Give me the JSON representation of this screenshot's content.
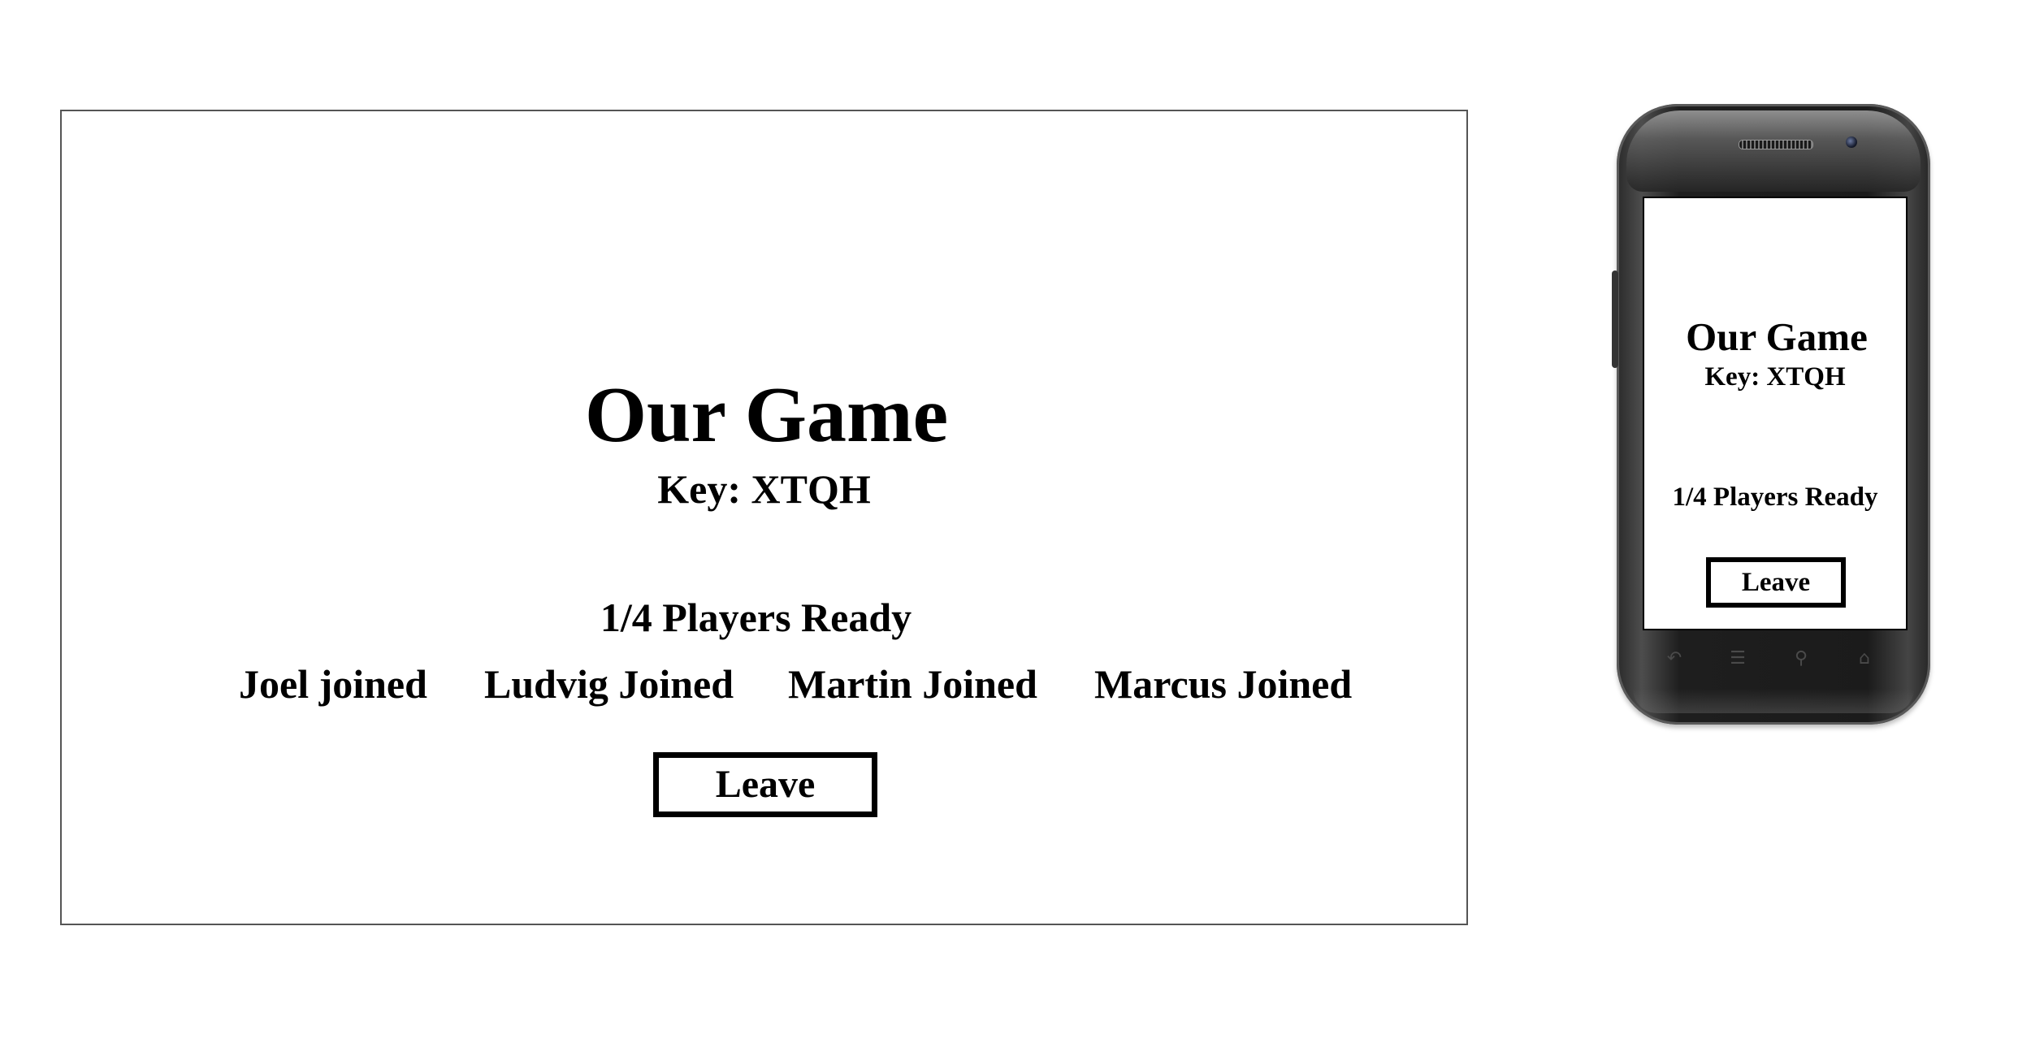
{
  "desktop": {
    "title": "Our Game",
    "key": "Key: XTQH",
    "ready_status": "1/4 Players Ready",
    "players": [
      "Joel joined",
      "Ludvig Joined",
      "Martin Joined",
      "Marcus Joined"
    ],
    "leave_label": "Leave"
  },
  "mobile": {
    "title": "Our Game",
    "key": "Key: XTQH",
    "ready_status": "1/4 Players Ready",
    "leave_label": "Leave",
    "nav_icons": [
      "back-icon",
      "menu-icon",
      "search-icon",
      "home-icon"
    ]
  }
}
